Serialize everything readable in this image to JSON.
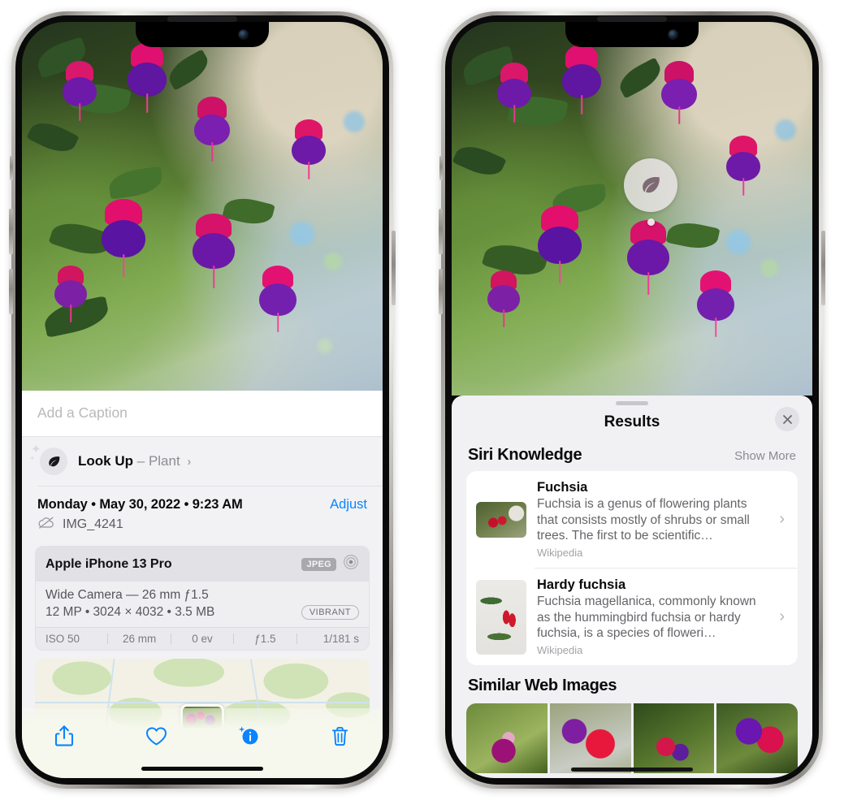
{
  "left_phone": {
    "caption": {
      "placeholder": "Add a Caption",
      "value": ""
    },
    "lookup": {
      "label": "Look Up",
      "dash": "–",
      "category": "Plant",
      "chevron": "›",
      "icon": "leaf-icon"
    },
    "date": {
      "text": "Monday • May 30, 2022 • 9:23 AM",
      "adjust_label": "Adjust"
    },
    "file": {
      "name": "IMG_4241",
      "icon": "icloud-slash-icon"
    },
    "camera": {
      "model": "Apple iPhone 13 Pro",
      "format_badge": "JPEG",
      "aperture_icon": "aperture-icon",
      "lens": "Wide Camera — 26 mm ƒ1.5",
      "specs": "12 MP • 3024 × 4032 • 3.5 MB",
      "style_badge": "VIBRANT",
      "exif": [
        "ISO 50",
        "26 mm",
        "0 ev",
        "ƒ1.5",
        "1/181 s"
      ]
    },
    "toolbar": [
      {
        "name": "share-button",
        "icon": "share-icon"
      },
      {
        "name": "favorite-button",
        "icon": "heart-icon"
      },
      {
        "name": "info-button",
        "icon": "info-sparkle-icon"
      },
      {
        "name": "delete-button",
        "icon": "trash-icon"
      }
    ],
    "accent_color": "#0a84ff"
  },
  "right_phone": {
    "badge": {
      "icon": "leaf-icon",
      "name": "visual-look-up-badge"
    },
    "sheet": {
      "title": "Results",
      "close_icon": "close-icon",
      "siri_section": {
        "title": "Siri Knowledge",
        "action": "Show More"
      },
      "knowledge_items": [
        {
          "title": "Fuchsia",
          "description": "Fuchsia is a genus of flowering plants that consists mostly of shrubs or small trees. The first to be scientific…",
          "source": "Wikipedia",
          "chevron": "›"
        },
        {
          "title": "Hardy fuchsia",
          "description": "Fuchsia magellanica, commonly known as the hummingbird fuchsia or hardy fuchsia, is a species of floweri…",
          "source": "Wikipedia",
          "chevron": "›"
        }
      ],
      "web_section": {
        "title": "Similar Web Images"
      },
      "web_images": [
        "web-image-1",
        "web-image-2",
        "web-image-3",
        "web-image-4"
      ]
    }
  }
}
